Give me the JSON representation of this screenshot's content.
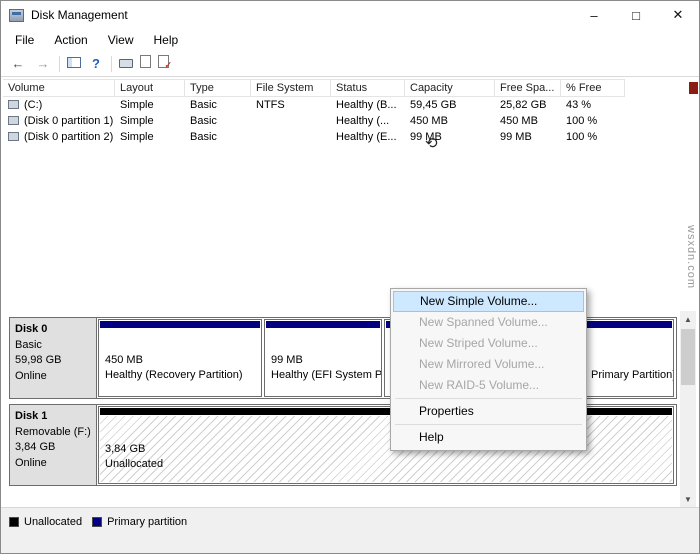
{
  "window": {
    "title": "Disk Management"
  },
  "icons": {
    "minimize": "–",
    "maximize": "□",
    "close": "✕",
    "back": "←",
    "forward": "→",
    "help": "?",
    "scroll_up": "▲",
    "scroll_down": "▼",
    "busy_cursor": "⟲"
  },
  "menu": {
    "file": "File",
    "action": "Action",
    "view": "View",
    "help": "Help"
  },
  "list": {
    "headers": [
      "Volume",
      "Layout",
      "Type",
      "File System",
      "Status",
      "Capacity",
      "Free Spa...",
      "% Free"
    ],
    "rows": [
      {
        "volume": "(C:)",
        "layout": "Simple",
        "type": "Basic",
        "fs": "NTFS",
        "status": "Healthy (B...",
        "capacity": "59,45 GB",
        "free": "25,82 GB",
        "pct": "43 %"
      },
      {
        "volume": "(Disk 0 partition 1)",
        "layout": "Simple",
        "type": "Basic",
        "fs": "",
        "status": "Healthy (...",
        "capacity": "450 MB",
        "free": "450 MB",
        "pct": "100 %"
      },
      {
        "volume": "(Disk 0 partition 2)",
        "layout": "Simple",
        "type": "Basic",
        "fs": "",
        "status": "Healthy (E...",
        "capacity": "99 MB",
        "free": "99 MB",
        "pct": "100 %"
      }
    ]
  },
  "graph": {
    "disk0": {
      "name": "Disk 0",
      "kind": "Basic",
      "size": "59,98 GB",
      "state": "Online",
      "p1": {
        "size": "450 MB",
        "status": "Healthy (Recovery Partition)"
      },
      "p2": {
        "size": "99 MB",
        "status": "Healthy (EFI System Pa"
      },
      "p3": {
        "status": "Primary Partition)"
      }
    },
    "disk1": {
      "name": "Disk 1",
      "kind": "Removable (F:)",
      "size": "3,84 GB",
      "state": "Online",
      "unalloc": {
        "size": "3,84 GB",
        "label": "Unallocated"
      }
    }
  },
  "context_menu": {
    "items": [
      {
        "label": "New Simple Volume...",
        "state": "highlighted"
      },
      {
        "label": "New Spanned Volume...",
        "state": "disabled"
      },
      {
        "label": "New Striped Volume...",
        "state": "disabled"
      },
      {
        "label": "New Mirrored Volume...",
        "state": "disabled"
      },
      {
        "label": "New RAID-5 Volume...",
        "state": "disabled"
      },
      {
        "label": "Properties",
        "state": "normal"
      },
      {
        "label": "Help",
        "state": "normal"
      }
    ]
  },
  "legend": {
    "unallocated": "Unallocated",
    "primary": "Primary partition"
  },
  "watermark": "wsxdn.com",
  "colors": {
    "primary_partition_stripe": "#000080",
    "unallocated_stripe": "#000000",
    "menu_highlight": "#cde8ff",
    "disk_label_bg": "#e0e0e0"
  }
}
